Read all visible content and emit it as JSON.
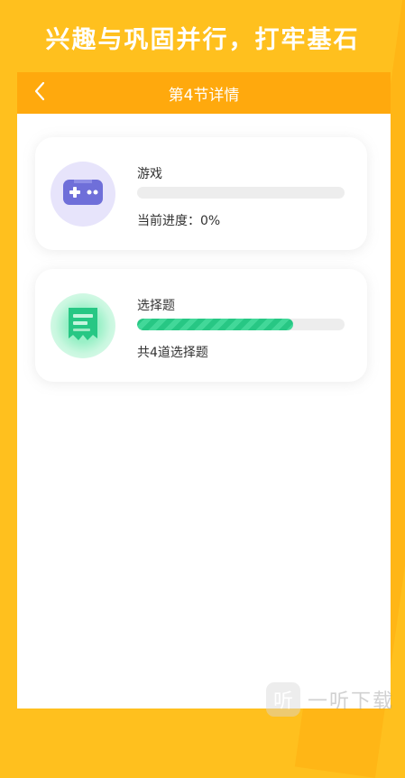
{
  "promo": {
    "title": "兴趣与巩固并行，打牢基石"
  },
  "header": {
    "title": "第4节详情",
    "back_icon": "chevron-left-icon"
  },
  "cards": [
    {
      "title": "游戏",
      "subtitle": "当前进度：0%",
      "progress": 0,
      "icon": "gamepad-icon",
      "accent": "#6f6fd9"
    },
    {
      "title": "选择题",
      "subtitle": "共4道选择题",
      "progress": 0.75,
      "icon": "quiz-icon",
      "accent": "#27c784"
    }
  ],
  "watermark": {
    "text": "一听下载",
    "logo_glyph": "听"
  },
  "colors": {
    "background": "#ffc01e",
    "header": "#ffa90d",
    "progress_fill": "#27c784",
    "progress_track": "#ededed"
  }
}
